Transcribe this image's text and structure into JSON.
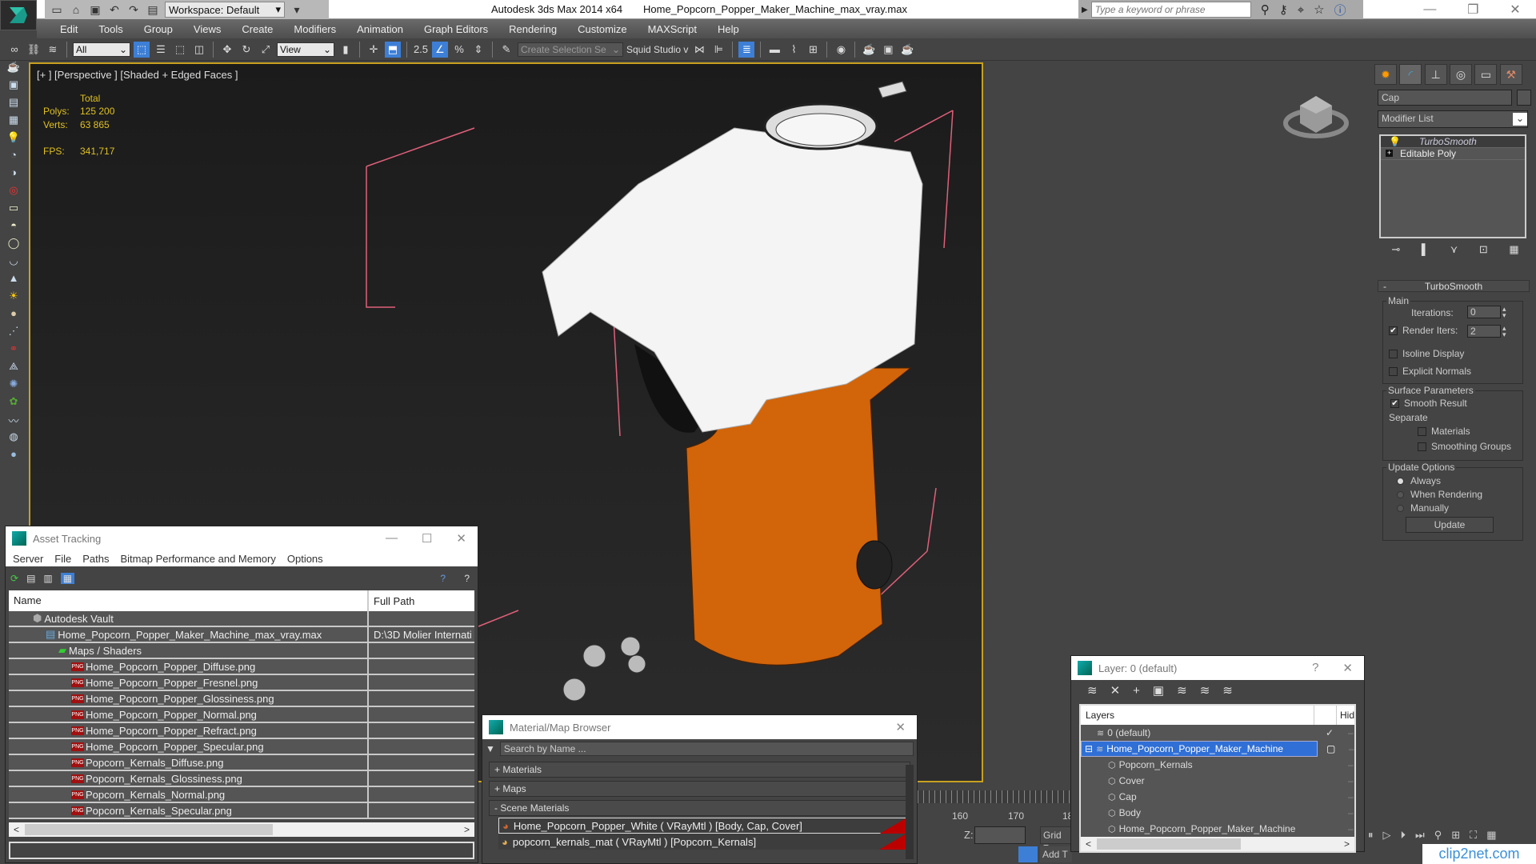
{
  "titlebar": {
    "workspace_label": "Workspace: Default",
    "app_title": "Autodesk 3ds Max  2014 x64",
    "file_title": "Home_Popcorn_Popper_Maker_Machine_max_vray.max",
    "search_placeholder": "Type a keyword or phrase",
    "icons": [
      "new-file-icon",
      "open-file-icon",
      "save-icon",
      "undo-icon",
      "redo-icon",
      "project-folder-icon"
    ],
    "right_icons": [
      "binoculars-icon",
      "key-icon",
      "satellite-icon",
      "star-icon",
      "help-icon"
    ]
  },
  "menubar": {
    "items": [
      "Edit",
      "Tools",
      "Group",
      "Views",
      "Create",
      "Modifiers",
      "Animation",
      "Graph Editors",
      "Rendering",
      "Customize",
      "MAXScript",
      "Help"
    ]
  },
  "toolbar": {
    "selection_filter": "All",
    "reference_coord": "View",
    "selection_set_placeholder": "Create Selection Se",
    "studio_label": "Squid Studio v"
  },
  "viewport": {
    "label": "[+ ] [Perspective ] [Shaded + Edged Faces ]",
    "stats": {
      "header": "Total",
      "polys_label": "Polys:",
      "polys_value": "125 200",
      "verts_label": "Verts:",
      "verts_value": "63 865",
      "fps_label": "FPS:",
      "fps_value": "341,717"
    }
  },
  "command_panel": {
    "object_name": "Cap",
    "modifier_list": "Modifier List",
    "stack": [
      {
        "label": "TurboSmooth",
        "selected": true
      },
      {
        "label": "Editable Poly",
        "selected": false
      }
    ],
    "rollout_title": "TurboSmooth",
    "main_group": "Main",
    "iterations_label": "Iterations:",
    "iterations_value": "0",
    "render_iters_label": "Render Iters:",
    "render_iters_value": "2",
    "render_iters_checked": true,
    "isoline_label": "Isoline Display",
    "explicit_normals_label": "Explicit Normals",
    "surface_group": "Surface Parameters",
    "smooth_result_label": "Smooth Result",
    "separate_label": "Separate",
    "materials_label": "Materials",
    "smoothing_groups_label": "Smoothing Groups",
    "update_group": "Update Options",
    "update_options": [
      "Always",
      "When Rendering",
      "Manually"
    ],
    "update_selected": "Always",
    "update_button": "Update"
  },
  "asset_tracking": {
    "title": "Asset Tracking",
    "menu": [
      "Server",
      "File",
      "Paths",
      "Bitmap Performance and Memory",
      "Options"
    ],
    "columns": [
      "Name",
      "Full Path"
    ],
    "rows": [
      {
        "name": "Autodesk Vault",
        "path": "",
        "type": "vault",
        "indent": 1
      },
      {
        "name": "Home_Popcorn_Popper_Maker_Machine_max_vray.max",
        "path": "D:\\3D Molier Internati",
        "type": "max",
        "indent": 2
      },
      {
        "name": "Maps / Shaders",
        "path": "",
        "type": "maps",
        "indent": 3
      },
      {
        "name": "Home_Popcorn_Popper_Diffuse.png",
        "path": "",
        "type": "png",
        "indent": 4
      },
      {
        "name": "Home_Popcorn_Popper_Fresnel.png",
        "path": "",
        "type": "png",
        "indent": 4
      },
      {
        "name": "Home_Popcorn_Popper_Glossiness.png",
        "path": "",
        "type": "png",
        "indent": 4
      },
      {
        "name": "Home_Popcorn_Popper_Normal.png",
        "path": "",
        "type": "png",
        "indent": 4
      },
      {
        "name": "Home_Popcorn_Popper_Refract.png",
        "path": "",
        "type": "png",
        "indent": 4
      },
      {
        "name": "Home_Popcorn_Popper_Specular.png",
        "path": "",
        "type": "png",
        "indent": 4
      },
      {
        "name": "Popcorn_Kernals_Diffuse.png",
        "path": "",
        "type": "png",
        "indent": 4
      },
      {
        "name": "Popcorn_Kernals_Glossiness.png",
        "path": "",
        "type": "png",
        "indent": 4
      },
      {
        "name": "Popcorn_Kernals_Normal.png",
        "path": "",
        "type": "png",
        "indent": 4
      },
      {
        "name": "Popcorn_Kernals_Specular.png",
        "path": "",
        "type": "png",
        "indent": 4
      }
    ]
  },
  "material_browser": {
    "title": "Material/Map Browser",
    "search_placeholder": "Search by Name ...",
    "rollouts": [
      "+ Materials",
      "+ Maps",
      "- Scene Materials"
    ],
    "materials": [
      "Home_Popcorn_Popper_White  ( VRayMtl )  [Body, Cap, Cover]",
      "popcorn_kernals_mat  ( VRayMtl )  [Popcorn_Kernals]"
    ]
  },
  "layer_dialog": {
    "title": "Layer: 0 (default)",
    "help": "?",
    "columns": [
      "Layers",
      "Hid"
    ],
    "rows": [
      {
        "label": "0 (default)",
        "type": "layer",
        "indent": 1,
        "current": true
      },
      {
        "label": "Home_Popcorn_Popper_Maker_Machine",
        "type": "layer",
        "indent": 0,
        "selected": true
      },
      {
        "label": "Popcorn_Kernals",
        "type": "object",
        "indent": 2
      },
      {
        "label": "Cover",
        "type": "object",
        "indent": 2
      },
      {
        "label": "Cap",
        "type": "object",
        "indent": 2
      },
      {
        "label": "Body",
        "type": "object",
        "indent": 2
      },
      {
        "label": "Home_Popcorn_Popper_Maker_Machine",
        "type": "object",
        "indent": 2
      }
    ]
  },
  "timeline": {
    "ticks": [
      "160",
      "170",
      "18"
    ],
    "z_label": "Z:",
    "grid_label": "Grid =",
    "add_time_tag": "Add T"
  },
  "watermark": "clip2net.com",
  "colors": {
    "accent_blue": "#3d7fd6",
    "viewport_border": "#c8a020",
    "stat_yellow": "#e0c020",
    "body_orange": "#d2640a"
  }
}
